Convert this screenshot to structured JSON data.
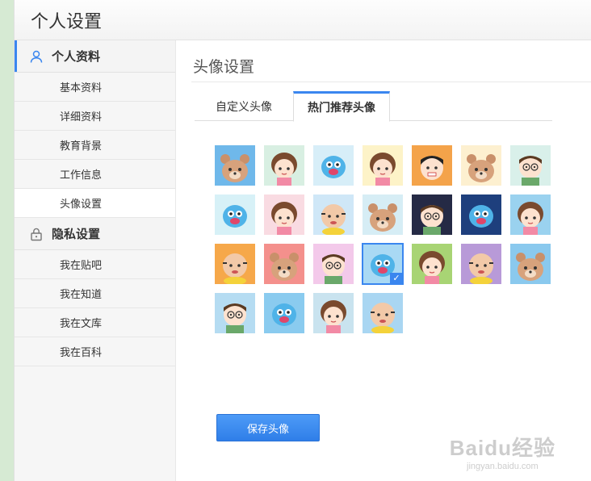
{
  "header": {
    "title": "个人设置"
  },
  "sidebar": {
    "sections": [
      {
        "label": "个人资料",
        "icon": "user-icon",
        "items": [
          "基本资料",
          "详细资料",
          "教育背景",
          "工作信息",
          "头像设置"
        ]
      },
      {
        "label": "隐私设置",
        "icon": "lock-icon",
        "items": [
          "我在贴吧",
          "我在知道",
          "我在文库",
          "我在百科"
        ]
      }
    ],
    "selected_item": "头像设置"
  },
  "main": {
    "title": "头像设置",
    "tabs": [
      {
        "label": "自定义头像"
      },
      {
        "label": "热门推荐头像",
        "active": true
      }
    ],
    "save_label": "保存头像",
    "selected_avatar_index": 17
  },
  "avatars": [
    {
      "subject": "bear",
      "bg": "#6fb8ea"
    },
    {
      "subject": "girl",
      "bg": "#d8efe2"
    },
    {
      "subject": "blue-creature",
      "bg": "#d7eef8"
    },
    {
      "subject": "girl",
      "bg": "#fdf3c8"
    },
    {
      "subject": "boy",
      "bg": "#f4a34a"
    },
    {
      "subject": "bear",
      "bg": "#fdf0d0"
    },
    {
      "subject": "boy-glasses",
      "bg": "#d9f0ea"
    },
    {
      "subject": "blue-creature",
      "bg": "#d7f1f7"
    },
    {
      "subject": "girl",
      "bg": "#f9dbe2"
    },
    {
      "subject": "baldman",
      "bg": "#cfe7f7"
    },
    {
      "subject": "bear",
      "bg": "#d6edf5"
    },
    {
      "subject": "boy-glasses",
      "bg": "#252a45"
    },
    {
      "subject": "blue-creature",
      "bg": "#1e3f7d"
    },
    {
      "subject": "girl",
      "bg": "#9ad2ef"
    },
    {
      "subject": "baldman",
      "bg": "#f6a84a"
    },
    {
      "subject": "bear",
      "bg": "#f4908c"
    },
    {
      "subject": "boy-glasses",
      "bg": "#f3c9ea"
    },
    {
      "subject": "blue-creature",
      "bg": "#a9d9f4"
    },
    {
      "subject": "girl",
      "bg": "#a8d474"
    },
    {
      "subject": "baldman",
      "bg": "#b89ad8"
    },
    {
      "subject": "bear",
      "bg": "#8ac9ee"
    },
    {
      "subject": "boy-glasses",
      "bg": "#b5dcf2"
    },
    {
      "subject": "blue-creature",
      "bg": "#8acbef"
    },
    {
      "subject": "girl",
      "bg": "#c9e3ef"
    },
    {
      "subject": "baldman",
      "bg": "#a9d6f2"
    }
  ],
  "watermark": {
    "line1": "Baidu经验",
    "line2": "jingyan.baidu.com"
  },
  "colors": {
    "accent": "#3a86ef",
    "page_bg": "#dcebd9"
  }
}
